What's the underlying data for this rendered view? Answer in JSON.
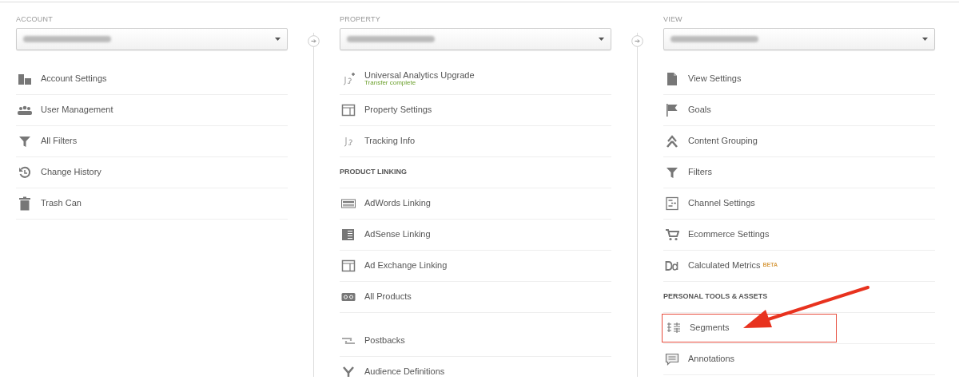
{
  "columns": [
    {
      "title": "ACCOUNT",
      "items": [
        {
          "kind": "item",
          "label": "Account Settings"
        },
        {
          "kind": "item",
          "label": "User Management"
        },
        {
          "kind": "item",
          "label": "All Filters"
        },
        {
          "kind": "item",
          "label": "Change History"
        },
        {
          "kind": "item",
          "label": "Trash Can"
        }
      ]
    },
    {
      "title": "PROPERTY",
      "items": [
        {
          "kind": "item",
          "label": "Universal Analytics Upgrade",
          "status": "Transfer complete"
        },
        {
          "kind": "item",
          "label": "Property Settings"
        },
        {
          "kind": "item",
          "label": "Tracking Info"
        },
        {
          "kind": "header",
          "label": "PRODUCT LINKING"
        },
        {
          "kind": "item",
          "label": "AdWords Linking"
        },
        {
          "kind": "item",
          "label": "AdSense Linking"
        },
        {
          "kind": "item",
          "label": "Ad Exchange Linking"
        },
        {
          "kind": "item",
          "label": "All Products"
        },
        {
          "kind": "spacer"
        },
        {
          "kind": "item",
          "label": "Postbacks"
        },
        {
          "kind": "item",
          "label": "Audience Definitions"
        }
      ]
    },
    {
      "title": "VIEW",
      "items": [
        {
          "kind": "item",
          "label": "View Settings"
        },
        {
          "kind": "item",
          "label": "Goals"
        },
        {
          "kind": "item",
          "label": "Content Grouping"
        },
        {
          "kind": "item",
          "label": "Filters"
        },
        {
          "kind": "item",
          "label": "Channel Settings"
        },
        {
          "kind": "item",
          "label": "Ecommerce Settings"
        },
        {
          "kind": "item",
          "label": "Calculated Metrics",
          "badge": "BETA"
        },
        {
          "kind": "header",
          "label": "PERSONAL TOOLS & ASSETS"
        },
        {
          "kind": "item",
          "label": "Segments",
          "highlighted": true
        },
        {
          "kind": "item",
          "label": "Annotations"
        }
      ]
    }
  ]
}
